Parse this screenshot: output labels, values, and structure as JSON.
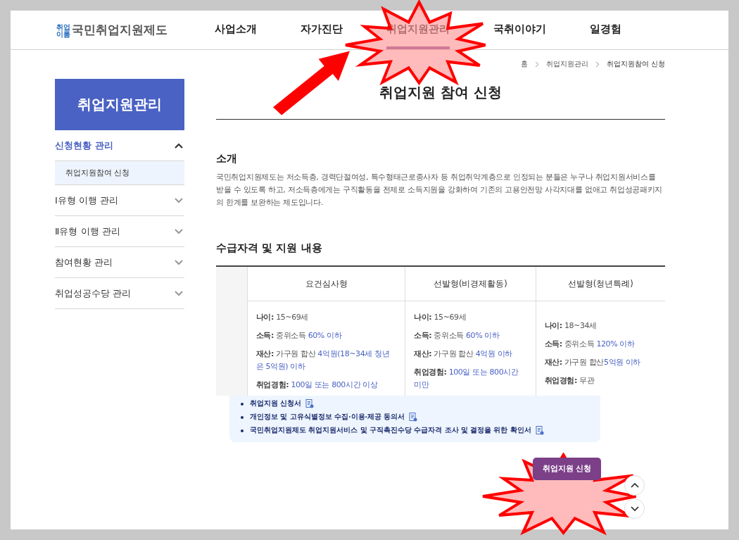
{
  "logo": {
    "badge_lines": [
      "취업",
      "이룸"
    ],
    "name": "국민취업지원제도"
  },
  "nav": [
    {
      "label": "사업소개",
      "selected": false
    },
    {
      "label": "자가진단",
      "selected": false
    },
    {
      "label": "취업지원관리",
      "selected": true
    },
    {
      "label": "국취이야기",
      "selected": false
    },
    {
      "label": "일경험",
      "selected": false
    }
  ],
  "breadcrumb": [
    "홈",
    "취업지원관리",
    "취업지원참여 신청"
  ],
  "sidebar": {
    "title": "취업지원관리",
    "items": [
      {
        "label": "신청현황 관리",
        "expanded": true,
        "children": [
          {
            "label": "취업지원참여 신청",
            "selected": true
          }
        ]
      },
      {
        "label": "Ⅰ유형 이행 관리",
        "expanded": false
      },
      {
        "label": "Ⅱ유형 이행 관리",
        "expanded": false
      },
      {
        "label": "참여현황 관리",
        "expanded": false
      },
      {
        "label": "취업성공수당 관리",
        "expanded": false
      }
    ]
  },
  "page_title": "취업지원 참여 신청",
  "intro": {
    "heading": "소개",
    "text": "국민취업지원제도는 저소득층, 경력단절여성, 특수형태근로종사자 등 취업취약계층으로 인정되는 분들은 누구나 취업지원서비스를 받을 수 있도록 하고, 저소득층에게는 구직활동을 전제로 소득지원을 강화하여 기존의 고용안전망 사각지대를 없애고 취업성공패키지의 한계를 보완하는 제도입니다."
  },
  "eligibility": {
    "heading": "수급자격 및 지원 내용",
    "columns": [
      {
        "title": "요건심사형",
        "conditions": [
          {
            "label": "나이:",
            "text": "15~69세"
          },
          {
            "label": "소득:",
            "text": "중위소득 ",
            "highlight": "60% 이하"
          },
          {
            "label": "재산:",
            "text": "가구원 합산 ",
            "highlight": "4억원(18~34세 청년은 5억원) 이하"
          },
          {
            "label": "취업경험:",
            "highlight": "100일 또는 800시간 이상"
          }
        ]
      },
      {
        "title": "선발형(비경제활동)",
        "conditions": [
          {
            "label": "나이:",
            "text": "15~69세"
          },
          {
            "label": "소득:",
            "text": "중위소득 ",
            "highlight": "60% 이하"
          },
          {
            "label": "재산:",
            "text": "가구원 합산 ",
            "highlight": "4억원 이하"
          },
          {
            "label": "취업경험:",
            "highlight": "100일 또는 800시간 미만"
          }
        ]
      },
      {
        "title": "선발형(청년특례)",
        "conditions": [
          {
            "label": "나이:",
            "text": "18~34세"
          },
          {
            "label": "소득:",
            "text": "중위소득 ",
            "highlight": "120% 이하"
          },
          {
            "label": "재산:",
            "text": "가구원 합산",
            "highlight": "5억원 이하"
          },
          {
            "label": "취업경험:",
            "text": "무관"
          }
        ]
      }
    ]
  },
  "documents": [
    "취업지원 신청서",
    "개인정보 및 고유식별정보 수집·이용·제공 동의서",
    "국민취업지원제도 취업지원서비스 및 구직촉진수당 수급자격 조사 및 결정을 위한 확인서"
  ],
  "apply_button": "취업지원 신청",
  "annotations": [
    {
      "kind": "arrow"
    },
    {
      "kind": "starburst"
    },
    {
      "kind": "starburst"
    }
  ]
}
